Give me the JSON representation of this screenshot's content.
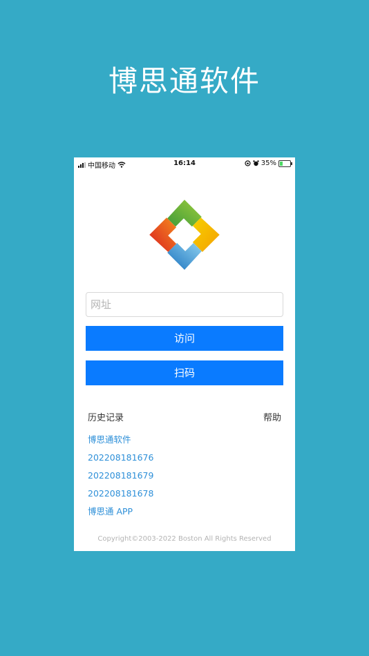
{
  "promo": {
    "title": "博思通软件"
  },
  "status_bar": {
    "carrier": "中国移动",
    "time": "16:14",
    "battery": "35%",
    "battery_level": 0.35
  },
  "login": {
    "url_placeholder": "网址",
    "visit_label": "访问",
    "scan_label": "扫码"
  },
  "history": {
    "title": "历史记录",
    "help_label": "帮助",
    "items": [
      "博思通软件",
      "202208181676",
      "202208181679",
      "202208181678",
      "博思通 APP"
    ]
  },
  "footer": {
    "copyright": "Copyright©2003-2022 Boston All Rights Reserved"
  },
  "colors": {
    "background": "#35aac6",
    "button": "#0a7bff",
    "link": "#2d8fd8"
  }
}
